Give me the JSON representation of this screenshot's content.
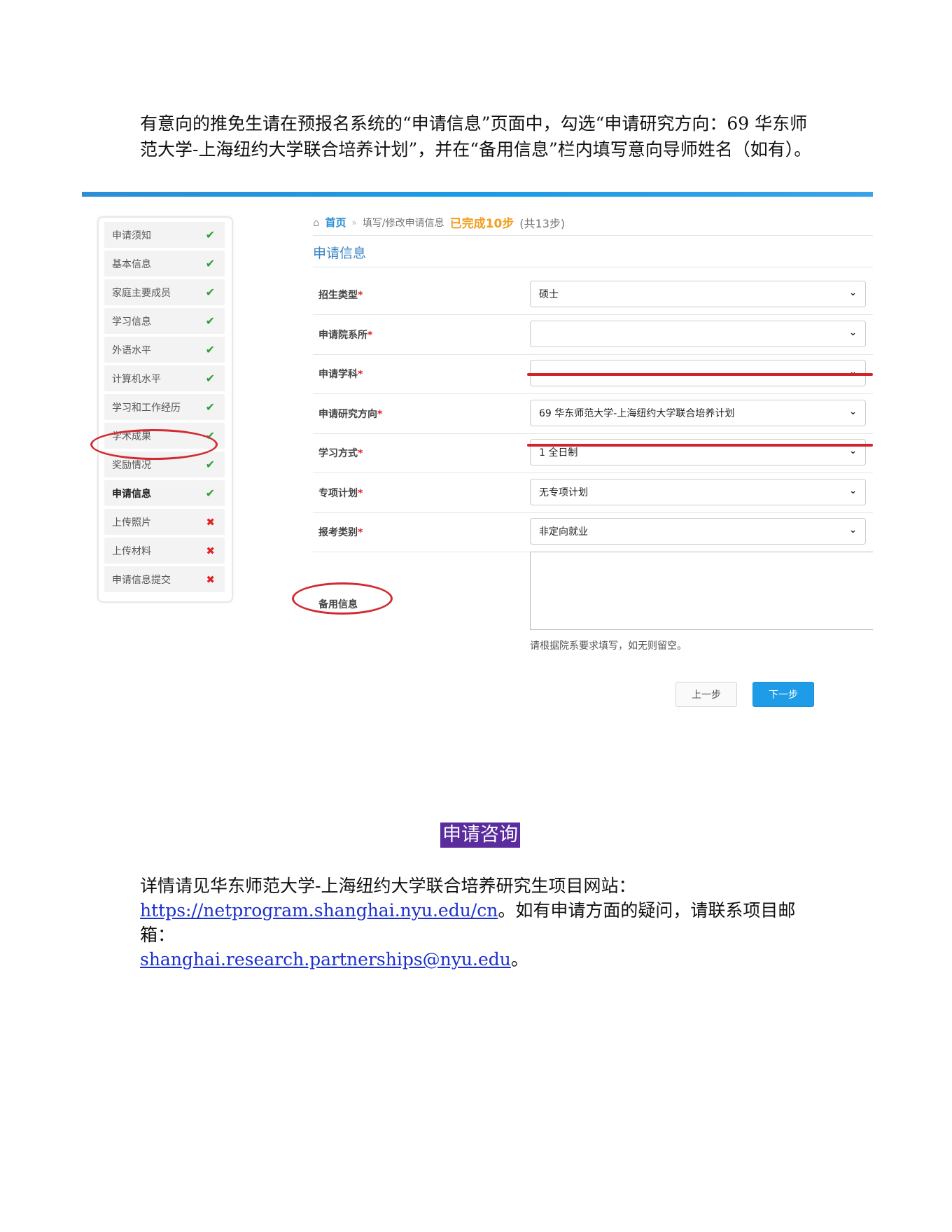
{
  "intro": {
    "text": "有意向的推免生请在预报名系统的“申请信息”页面中，勾选“申请研究方向：69 华东师范大学-上海纽约大学联合培养计划”，并在“备用信息”栏内填写意向导师姓名（如有）。"
  },
  "steps": [
    {
      "label": "申请须知",
      "status": "done"
    },
    {
      "label": "基本信息",
      "status": "done"
    },
    {
      "label": "家庭主要成员",
      "status": "done"
    },
    {
      "label": "学习信息",
      "status": "done"
    },
    {
      "label": "外语水平",
      "status": "done"
    },
    {
      "label": "计算机水平",
      "status": "done"
    },
    {
      "label": "学习和工作经历",
      "status": "done"
    },
    {
      "label": "学术成果",
      "status": "done"
    },
    {
      "label": "奖励情况",
      "status": "done"
    },
    {
      "label": "申请信息",
      "status": "done"
    },
    {
      "label": "上传照片",
      "status": "todo"
    },
    {
      "label": "上传材料",
      "status": "todo"
    },
    {
      "label": "申请信息提交",
      "status": "todo"
    }
  ],
  "icons": {
    "done": "check-icon",
    "todo": "cross-icon",
    "home": "home-icon",
    "select": "chevron-down-icon"
  },
  "marks": {
    "done": "✔",
    "todo": "✖",
    "chevron": "⌄",
    "home": "⌂",
    "sep": "»"
  },
  "breadcrumb": {
    "home": "首页",
    "current": "填写/修改申请信息",
    "progress": "已完成10步",
    "total": "(共13步)"
  },
  "section_title": "申请信息",
  "form": {
    "fields": [
      {
        "label": "招生类型",
        "value": "硕士"
      },
      {
        "label": "申请院系所",
        "value": ""
      },
      {
        "label": "申请学科",
        "value": ""
      },
      {
        "label": "申请研究方向",
        "value": "69 华东师范大学-上海纽约大学联合培养计划"
      },
      {
        "label": "学习方式",
        "value": "1 全日制"
      },
      {
        "label": "专项计划",
        "value": "无专项计划"
      },
      {
        "label": "报考类别",
        "value": "非定向就业"
      }
    ],
    "required_mark": "*",
    "spare_label": "备用信息",
    "hint": "请根据院系要求填写，如无则留空。",
    "prev_button": "上一步",
    "next_button": "下一步"
  },
  "contact": {
    "heading": "申请咨询",
    "line1": "详情请见华东师范大学-上海纽约大学联合培养研究生项目网站：",
    "url": "https://netprogram.shanghai.nyu.edu/cn",
    "mid": "。如有申请方面的疑问，请联系项目邮箱：",
    "email": "shanghai.research.partnerships@nyu.edu",
    "end": "。"
  },
  "colors": {
    "accent_blue": "#1f9ce8",
    "highlight_red": "#d2232b",
    "heading_bg": "#5a2c9d",
    "check_green": "#2e9e36"
  }
}
